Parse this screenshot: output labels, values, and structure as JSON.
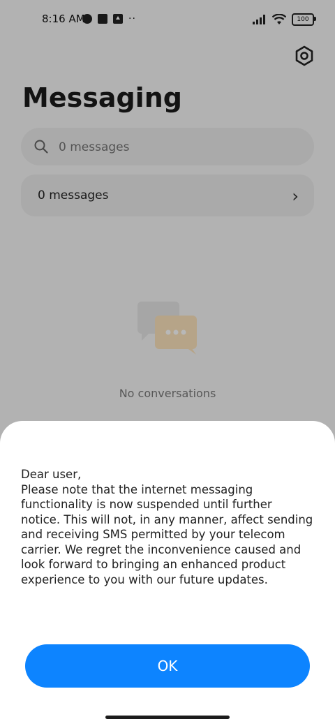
{
  "status_bar": {
    "time": "8:16 AM",
    "battery": "100"
  },
  "header": {
    "title": "Messaging"
  },
  "search": {
    "placeholder": "0 messages"
  },
  "list_row": {
    "label": "0 messages"
  },
  "empty_state": {
    "text": "No conversations"
  },
  "dialog": {
    "message": "Dear user,\nPlease note that the internet messaging functionality is now suspended until further notice. This will not, in any manner, affect sending and receiving SMS permitted by your telecom carrier. We regret the inconvenience caused and look forward to bringing an enhanced product experience to you with our future updates.",
    "ok_label": "OK"
  },
  "colors": {
    "accent": "#0d84ff",
    "background": "#f7f7f7",
    "sheet": "#ffffff"
  },
  "icons": [
    "gear-icon",
    "search-icon",
    "chevron-right-icon",
    "chat-bubbles-icon",
    "wifi-icon",
    "signal-icon",
    "battery-icon"
  ]
}
